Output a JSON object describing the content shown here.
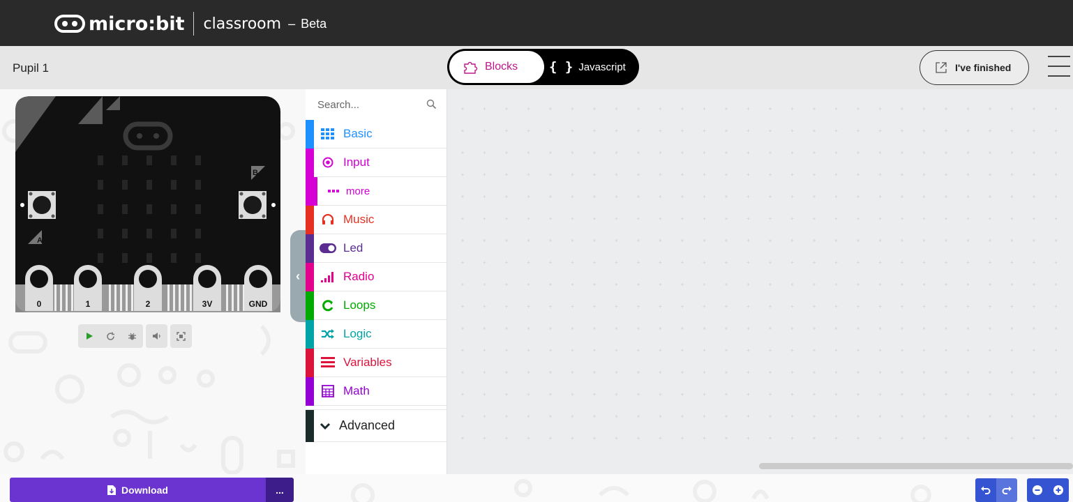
{
  "header": {
    "brand_name": "micro:bit",
    "brand_sub": "classroom",
    "brand_dash": "–",
    "brand_tag": "Beta"
  },
  "menubar": {
    "pupil_name": "Pupil 1",
    "mode_blocks": "Blocks",
    "mode_js_braces": "{ }",
    "mode_js": "Javascript",
    "finished_label": "I've finished"
  },
  "board": {
    "button_a": "A",
    "button_b": "B",
    "pins": [
      "0",
      "1",
      "2",
      "3V",
      "GND"
    ]
  },
  "toolbox": {
    "search_placeholder": "Search...",
    "categories": [
      {
        "label": "Basic",
        "color": "#1e90ff",
        "icon": "grid-icon"
      },
      {
        "label": "Input",
        "color": "#d400d4",
        "icon": "target-icon"
      },
      {
        "label": "more",
        "color": "#d400d4",
        "icon": "dots-icon"
      },
      {
        "label": "Music",
        "color": "#e63022",
        "icon": "headphones-icon"
      },
      {
        "label": "Led",
        "color": "#5c2d91",
        "icon": "toggle-icon"
      },
      {
        "label": "Radio",
        "color": "#e3008c",
        "icon": "signal-icon"
      },
      {
        "label": "Loops",
        "color": "#00aa00",
        "icon": "loop-icon"
      },
      {
        "label": "Logic",
        "color": "#00a4a6",
        "icon": "shuffle-icon"
      },
      {
        "label": "Variables",
        "color": "#dc143c",
        "icon": "lines-icon"
      },
      {
        "label": "Math",
        "color": "#9400d3",
        "icon": "calculator-icon"
      }
    ],
    "advanced_label": "Advanced"
  },
  "bottom": {
    "download_label": "Download",
    "more_label": "..."
  },
  "colors": {
    "accent": "#6b33cf",
    "accent_dark": "#3d1d8a",
    "workspace_btn": "#3454d1"
  }
}
